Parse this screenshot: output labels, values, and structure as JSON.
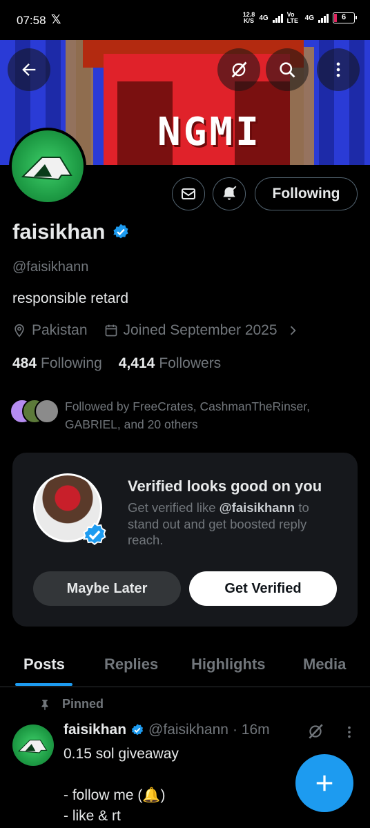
{
  "status_bar": {
    "time": "07:58",
    "app_icon": "x-logo-icon",
    "speed_value": "12.8",
    "speed_unit": "K/S",
    "network1": "4G",
    "network2": "Vo LTE",
    "network3": "4G",
    "battery": "6"
  },
  "banner": {
    "text": "NGMI",
    "colors": {
      "blue": "#2a3bd6",
      "red": "#e0222a"
    }
  },
  "header": {
    "back_icon": "back-arrow-icon",
    "grok_icon": "grok-icon",
    "search_icon": "search-icon",
    "more_icon": "more-vertical-icon"
  },
  "profile": {
    "name": "faisikhan",
    "handle": "@faisikhann",
    "bio": "responsible retard",
    "location": "Pakistan",
    "joined": "Joined September 2025",
    "following_count": "484",
    "following_label": "Following",
    "followers_count": "4,414",
    "followers_label": "Followers",
    "followed_by": "Followed by FreeCrates, CashmanTheRinser, GABRIEL, and 20 others"
  },
  "actions": {
    "message_icon": "message-icon",
    "notify_icon": "bell-check-icon",
    "following_label": "Following"
  },
  "verified_card": {
    "title": "Verified looks good on you",
    "desc_prefix": "Get verified like ",
    "desc_handle": "@faisikhann",
    "desc_suffix": " to stand out and get boosted reply reach.",
    "maybe_label": "Maybe Later",
    "verify_label": "Get Verified"
  },
  "tabs": [
    {
      "label": "Posts",
      "active": true
    },
    {
      "label": "Replies",
      "active": false
    },
    {
      "label": "Highlights",
      "active": false
    },
    {
      "label": "Media",
      "active": false
    }
  ],
  "post": {
    "pinned_label": "Pinned",
    "name": "faisikhan",
    "handle": "@faisikhann",
    "time": "· 16m",
    "text": "0.15 sol giveaway\n\n- follow me (🔔)\n- like & rt"
  },
  "accent": "#1d9bf0"
}
